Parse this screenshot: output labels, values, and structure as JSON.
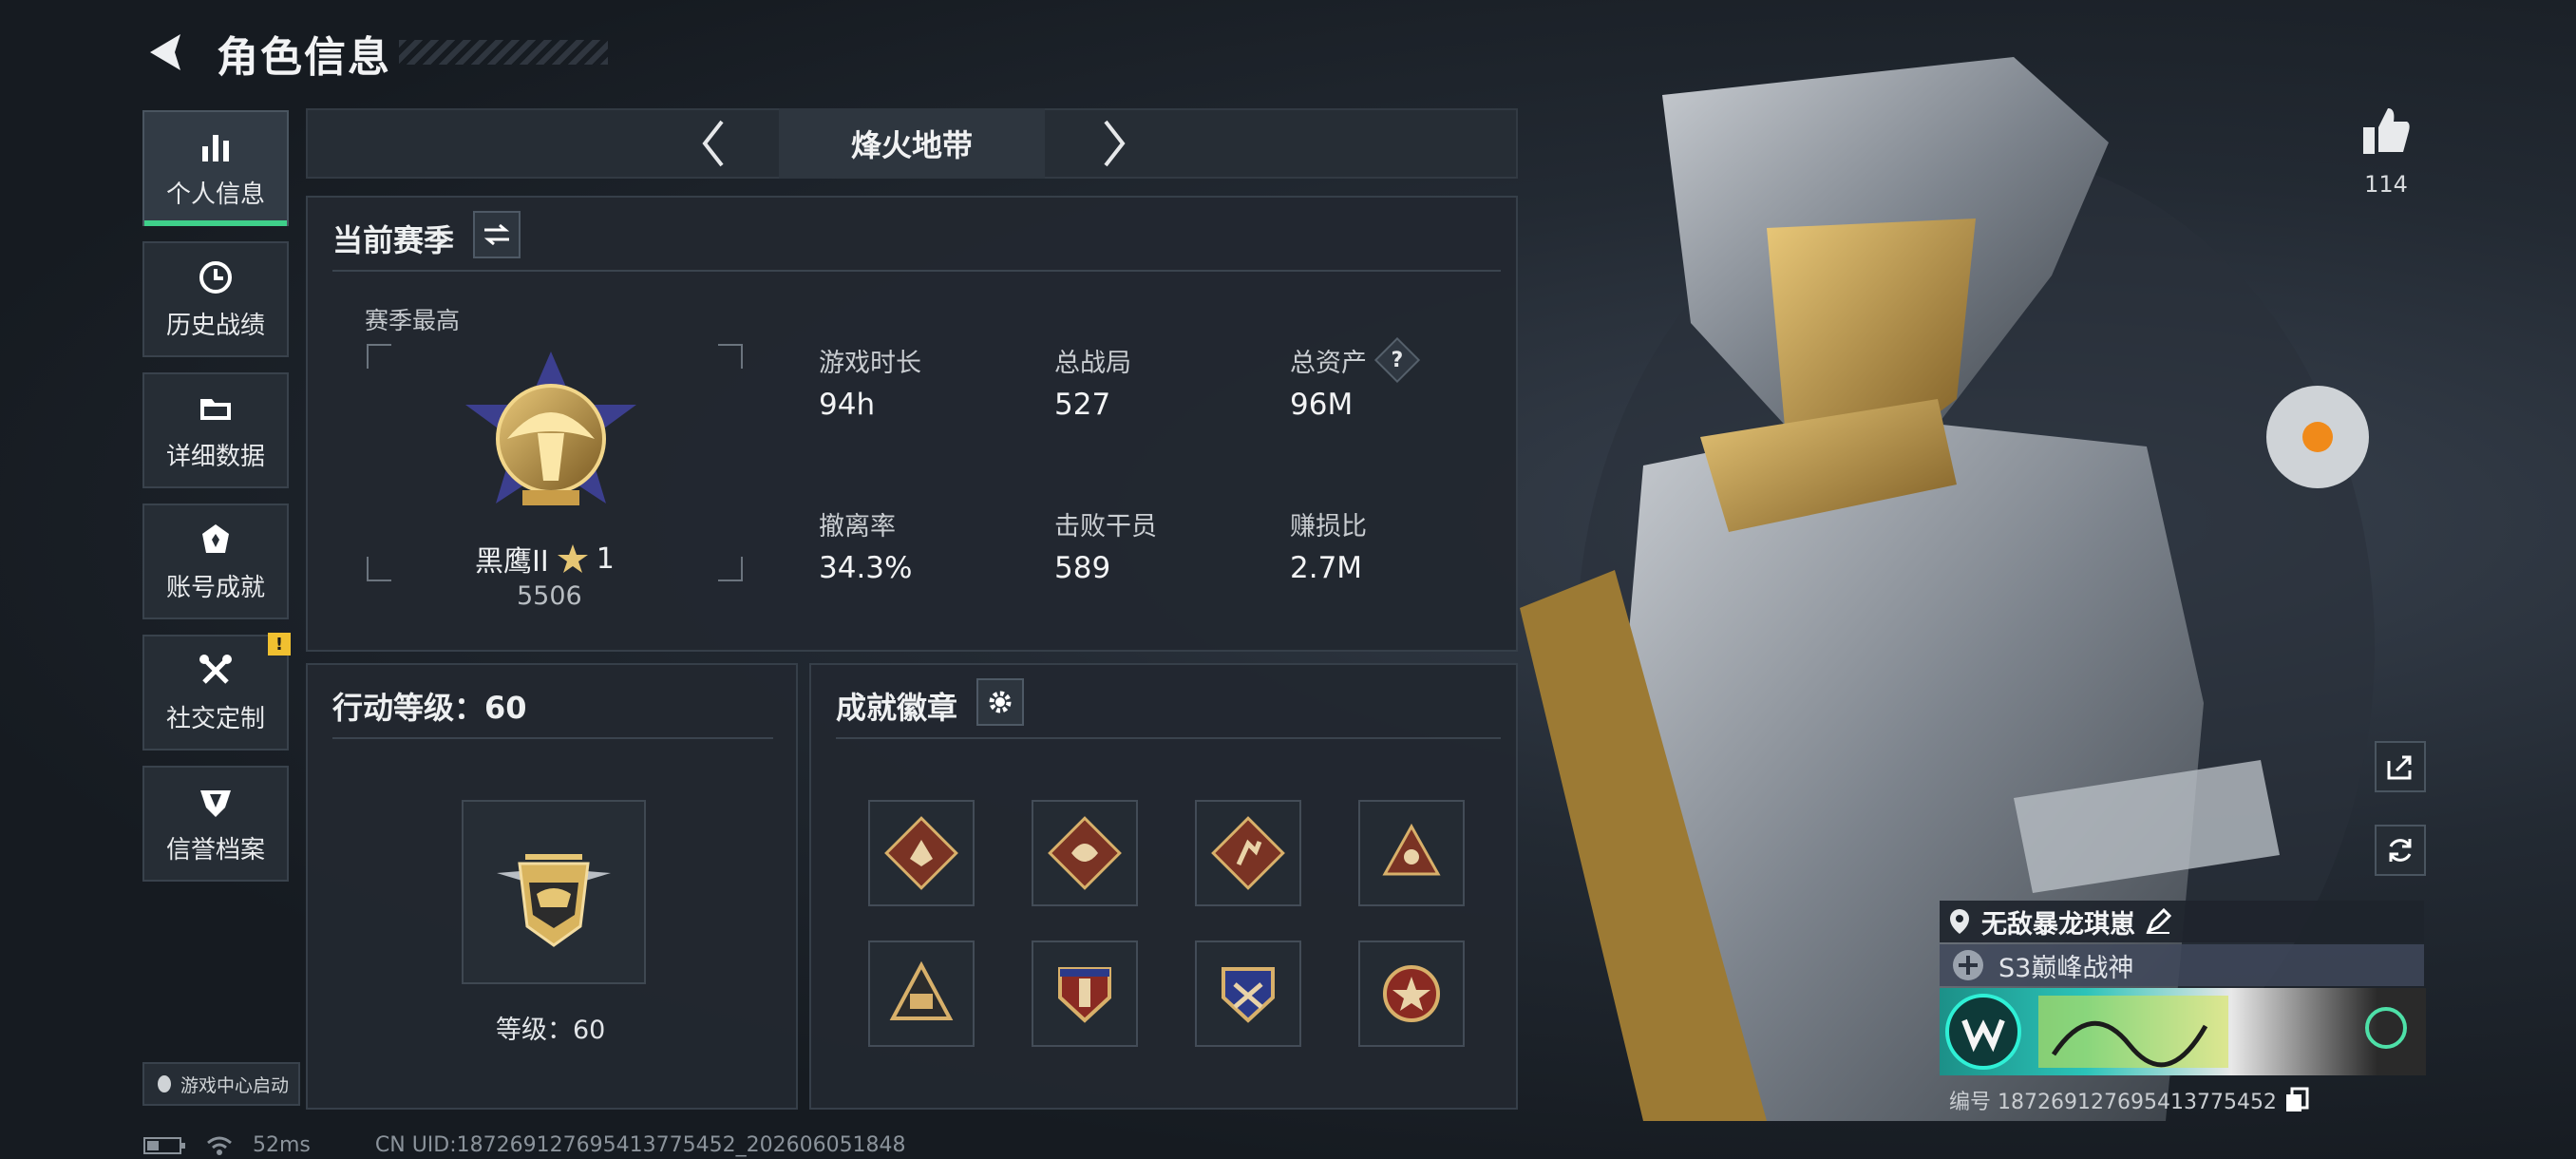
{
  "header": {
    "title": "角色信息"
  },
  "sidebar": {
    "items": [
      {
        "label": "个人信息",
        "icon": "bar-chart-icon",
        "active": true
      },
      {
        "label": "历史战绩",
        "icon": "clock-icon"
      },
      {
        "label": "详细数据",
        "icon": "folder-icon"
      },
      {
        "label": "账号成就",
        "icon": "achievement-icon"
      },
      {
        "label": "社交定制",
        "icon": "wrench-icon",
        "badge": "!"
      },
      {
        "label": "信誉档案",
        "icon": "shield-icon"
      }
    ],
    "launch_label": "游戏中心启动"
  },
  "mode": {
    "name": "烽火地带"
  },
  "season": {
    "heading": "当前赛季",
    "best_label": "赛季最高",
    "rank_name": "黑鹰II",
    "rank_star": "1",
    "rank_score": "5506",
    "stats": [
      {
        "label": "游戏时长",
        "value": "94h"
      },
      {
        "label": "总战局",
        "value": "527"
      },
      {
        "label": "总资产",
        "value": "96M",
        "help": "?"
      },
      {
        "label": "撤离率",
        "value": "34.3%"
      },
      {
        "label": "击败干员",
        "value": "589"
      },
      {
        "label": "赚损比",
        "value": "2.7M"
      }
    ]
  },
  "action_level": {
    "heading": "行动等级：60",
    "level_label": "等级：60"
  },
  "badges": {
    "heading": "成就徽章"
  },
  "likes": {
    "count": "114"
  },
  "profile": {
    "name": "无敌暴龙琪崽",
    "title": "S3巅峰战神",
    "id_text": "编号 187269127695413775452"
  },
  "status_bar": {
    "ping": "52ms",
    "uid": "CN UID:187269127695413775452_202606051848"
  },
  "colors": {
    "accent": "#3fd08a",
    "warning": "#f0c030",
    "panel": "#222830"
  }
}
